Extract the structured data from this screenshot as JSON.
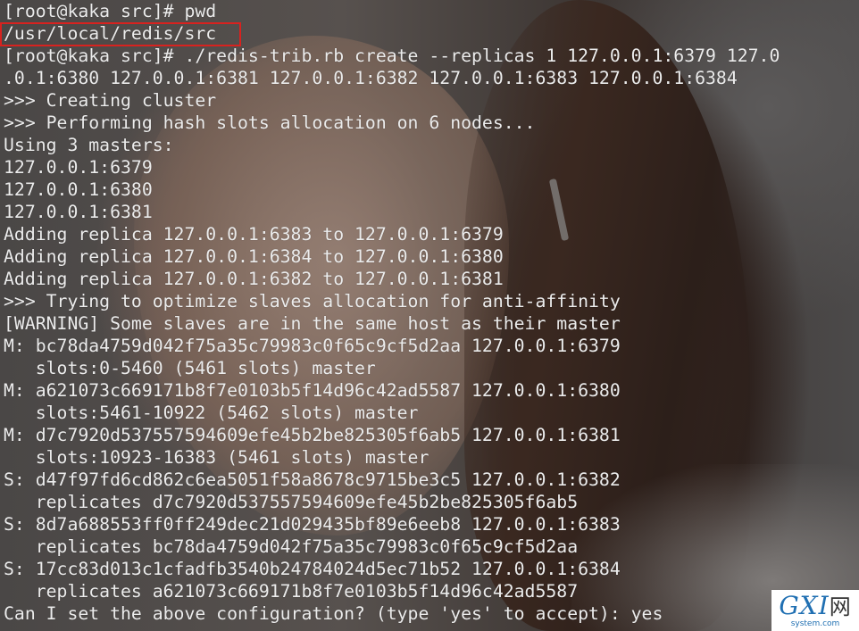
{
  "terminal": {
    "lines": [
      "[root@kaka src]# pwd",
      "/usr/local/redis/src",
      "[root@kaka src]# ./redis-trib.rb create --replicas 1 127.0.0.1:6379 127.0",
      ".0.1:6380 127.0.0.1:6381 127.0.0.1:6382 127.0.0.1:6383 127.0.0.1:6384",
      ">>> Creating cluster",
      ">>> Performing hash slots allocation on 6 nodes...",
      "Using 3 masters:",
      "127.0.0.1:6379",
      "127.0.0.1:6380",
      "127.0.0.1:6381",
      "Adding replica 127.0.0.1:6383 to 127.0.0.1:6379",
      "Adding replica 127.0.0.1:6384 to 127.0.0.1:6380",
      "Adding replica 127.0.0.1:6382 to 127.0.0.1:6381",
      ">>> Trying to optimize slaves allocation for anti-affinity",
      "[WARNING] Some slaves are in the same host as their master",
      "M: bc78da4759d042f75a35c79983c0f65c9cf5d2aa 127.0.0.1:6379",
      "   slots:0-5460 (5461 slots) master",
      "M: a621073c669171b8f7e0103b5f14d96c42ad5587 127.0.0.1:6380",
      "   slots:5461-10922 (5462 slots) master",
      "M: d7c7920d537557594609efe45b2be825305f6ab5 127.0.0.1:6381",
      "   slots:10923-16383 (5461 slots) master",
      "S: d47f97fd6cd862c6ea5051f58a8678c9715be3c5 127.0.0.1:6382",
      "   replicates d7c7920d537557594609efe45b2be825305f6ab5",
      "S: 8d7a688553ff0ff249dec21d029435bf89e6eeb8 127.0.0.1:6383",
      "   replicates bc78da4759d042f75a35c79983c0f65c9cf5d2aa",
      "S: 17cc83d013c1cfadfb3540b24784024d5ec71b52 127.0.0.1:6384",
      "   replicates a621073c669171b8f7e0103b5f14d96c42ad5587",
      "Can I set the above configuration? (type 'yes' to accept): yes"
    ],
    "highlight_color": "#d8221f"
  },
  "watermark": {
    "logo": "GXI",
    "logo_cn": "网",
    "domain": "system.com"
  }
}
